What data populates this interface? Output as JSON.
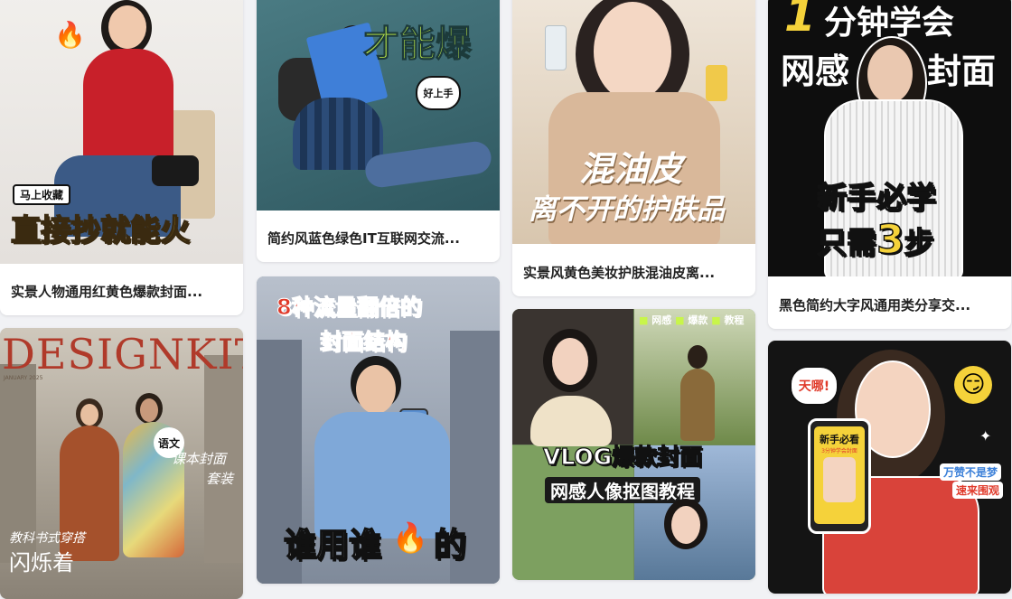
{
  "cards": [
    {
      "caption": "实景人物通用红黄色爆款封面...",
      "tag": "马上收藏",
      "headline": "直接抄就能火"
    },
    {
      "caption": "简约风蓝色绿色IT互联网交流...",
      "headline": "才能爆",
      "bubble": "好上手"
    },
    {
      "caption": "实景风黄色美妆护肤混油皮离...",
      "headline1": "混油皮",
      "headline2": "离不开的护肤品"
    },
    {
      "caption": "黑色简约大字风通用类分享交...",
      "top1": "1",
      "top2": "分钟学会",
      "top3": "网感",
      "top4": "封面",
      "line1": "新手必学",
      "line2a": "只需",
      "line2num": "3",
      "line2b": "步"
    },
    {
      "masthead": "DESIGNKIT",
      "issue": "JANUARY 2025",
      "side_text": "课本封面",
      "side_text2": "套装",
      "sticker": "语文",
      "bottom1": "教科书式穿搭",
      "bottom2": "闪烁着"
    },
    {
      "title1": "8种流量翻倍的",
      "title2": "封面结构",
      "bottom_a": "谁用谁",
      "bottom_b": "的"
    },
    {
      "tags": [
        "网感",
        "爆款",
        "教程"
      ],
      "title": "VLOG爆款封面",
      "subtitle": "网感人像抠图教程"
    },
    {
      "bubble": "天哪!",
      "phone_title": "新手必看",
      "phone_sub": "3分钟学会封面",
      "side1": "万赞不是梦",
      "side2": "速来围观",
      "emoji": "smirk-emoji-icon"
    }
  ],
  "colors": {
    "page_bg": "#f1f2f5",
    "yellow": "#f5d23a",
    "green_accent": "#c8f54a",
    "red": "#e03a2a",
    "black": "#111111"
  }
}
